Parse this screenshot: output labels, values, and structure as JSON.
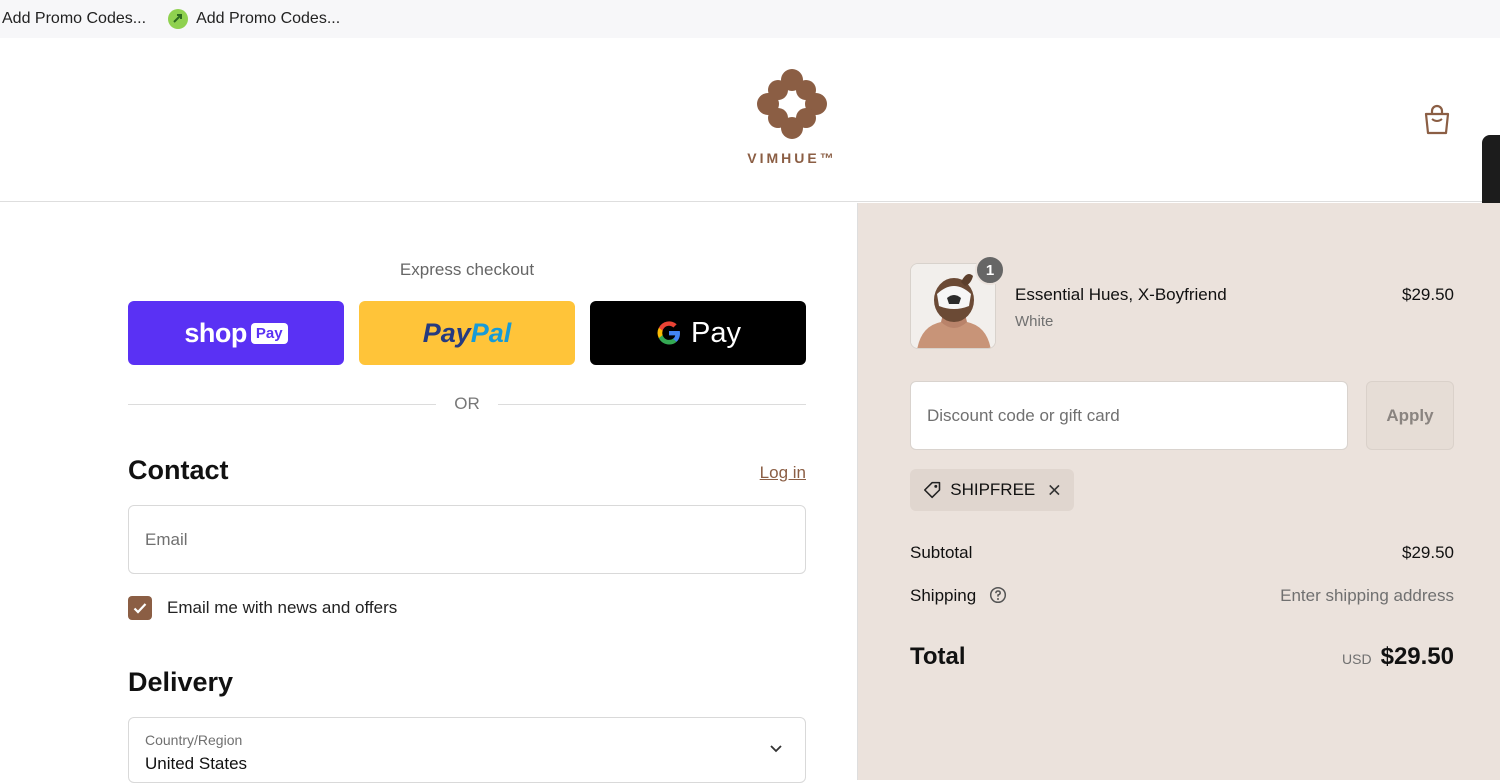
{
  "bookmarks": [
    {
      "label": "Add Promo Codes..."
    },
    {
      "label": "Add Promo Codes...",
      "icon": "promo-extension-icon"
    }
  ],
  "header": {
    "brand": "VIMHUE™",
    "brand_color": "#8b5e44",
    "cart_icon": "shopping-bag-icon"
  },
  "express": {
    "title": "Express checkout",
    "buttons": {
      "shop_pay": {
        "word": "shop",
        "pill": "Pay",
        "color": "#5a31f4"
      },
      "paypal": {
        "part1": "Pay",
        "part2": "Pal",
        "color": "#ffc439"
      },
      "gpay": {
        "g": "G",
        "word": "Pay",
        "color": "#000000"
      }
    },
    "or_label": "OR"
  },
  "contact": {
    "heading": "Contact",
    "login_label": "Log in",
    "email_placeholder": "Email",
    "newsletter_label": "Email me with news and offers",
    "newsletter_checked": true
  },
  "delivery": {
    "heading": "Delivery",
    "country_label": "Country/Region",
    "country_value": "United States"
  },
  "order": {
    "item": {
      "name": "Essential Hues, X-Boyfriend",
      "variant": "White",
      "price": "$29.50",
      "quantity": "1"
    },
    "discount_placeholder": "Discount code or gift card",
    "apply_label": "Apply",
    "applied_code": "SHIPFREE",
    "subtotal_label": "Subtotal",
    "subtotal_value": "$29.50",
    "shipping_label": "Shipping",
    "shipping_value": "Enter shipping address",
    "total_label": "Total",
    "currency": "USD",
    "total_value": "$29.50"
  }
}
